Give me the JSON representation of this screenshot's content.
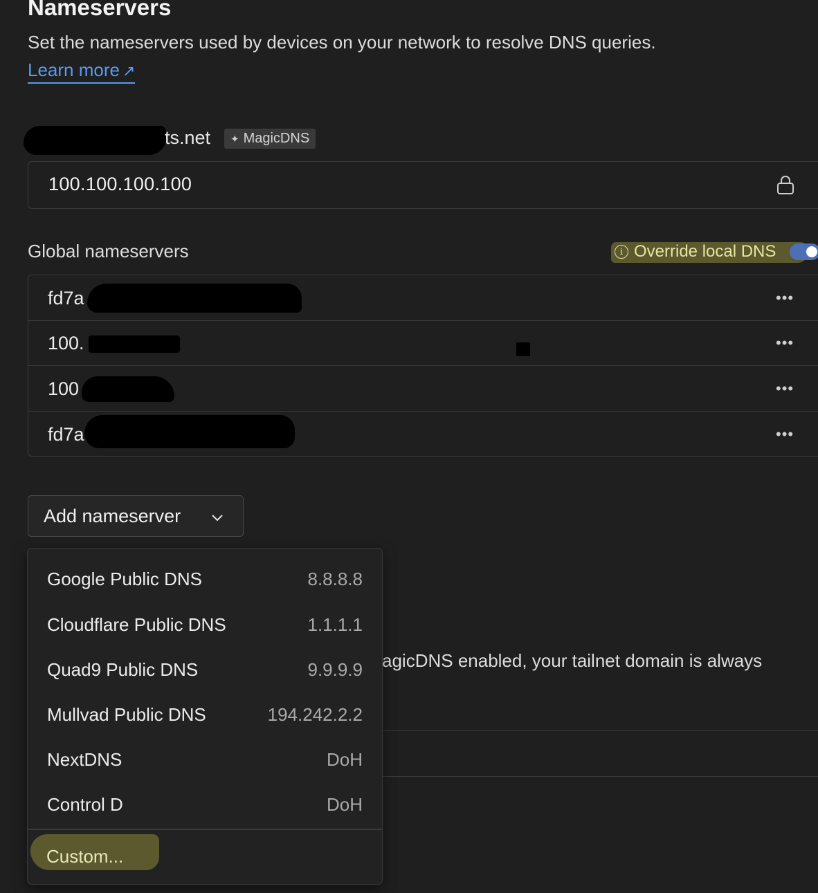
{
  "section": {
    "title": "Nameservers",
    "description": "Set the nameservers used by devices on your network to resolve DNS queries.",
    "learn_more": "Learn more",
    "learn_more_icon": "external-arrow-icon"
  },
  "tailnet": {
    "domain_suffix": "ts.net",
    "badge": "MagicDNS",
    "badge_icon": "sparkle-icon",
    "resolver": "100.100.100.100",
    "lock_icon": "lock-icon"
  },
  "global": {
    "label": "Global nameservers",
    "override_label": "Override local DNS",
    "override_enabled": true,
    "nameservers": [
      {
        "prefix": "fd7a"
      },
      {
        "prefix": "100."
      },
      {
        "prefix": "100"
      },
      {
        "prefix": "fd7a"
      }
    ],
    "row_menu_icon": "ellipsis-icon"
  },
  "add_button": {
    "label": "Add nameserver",
    "icon": "chevron-down-icon"
  },
  "background_text": "agicDNS enabled, your tailnet domain is always",
  "dropdown": {
    "items": [
      {
        "name": "Google Public DNS",
        "value": "8.8.8.8"
      },
      {
        "name": "Cloudflare Public DNS",
        "value": "1.1.1.1"
      },
      {
        "name": "Quad9 Public DNS",
        "value": "9.9.9.9"
      },
      {
        "name": "Mullvad Public DNS",
        "value": "194.242.2.2"
      },
      {
        "name": "NextDNS",
        "value": "DoH"
      },
      {
        "name": "Control D",
        "value": "DoH"
      }
    ],
    "custom": "Custom..."
  },
  "colors": {
    "background": "#1f1f1f",
    "link": "#5b9af1",
    "toggle_on": "#4c6fb5",
    "highlight": "#5f5d2e"
  }
}
